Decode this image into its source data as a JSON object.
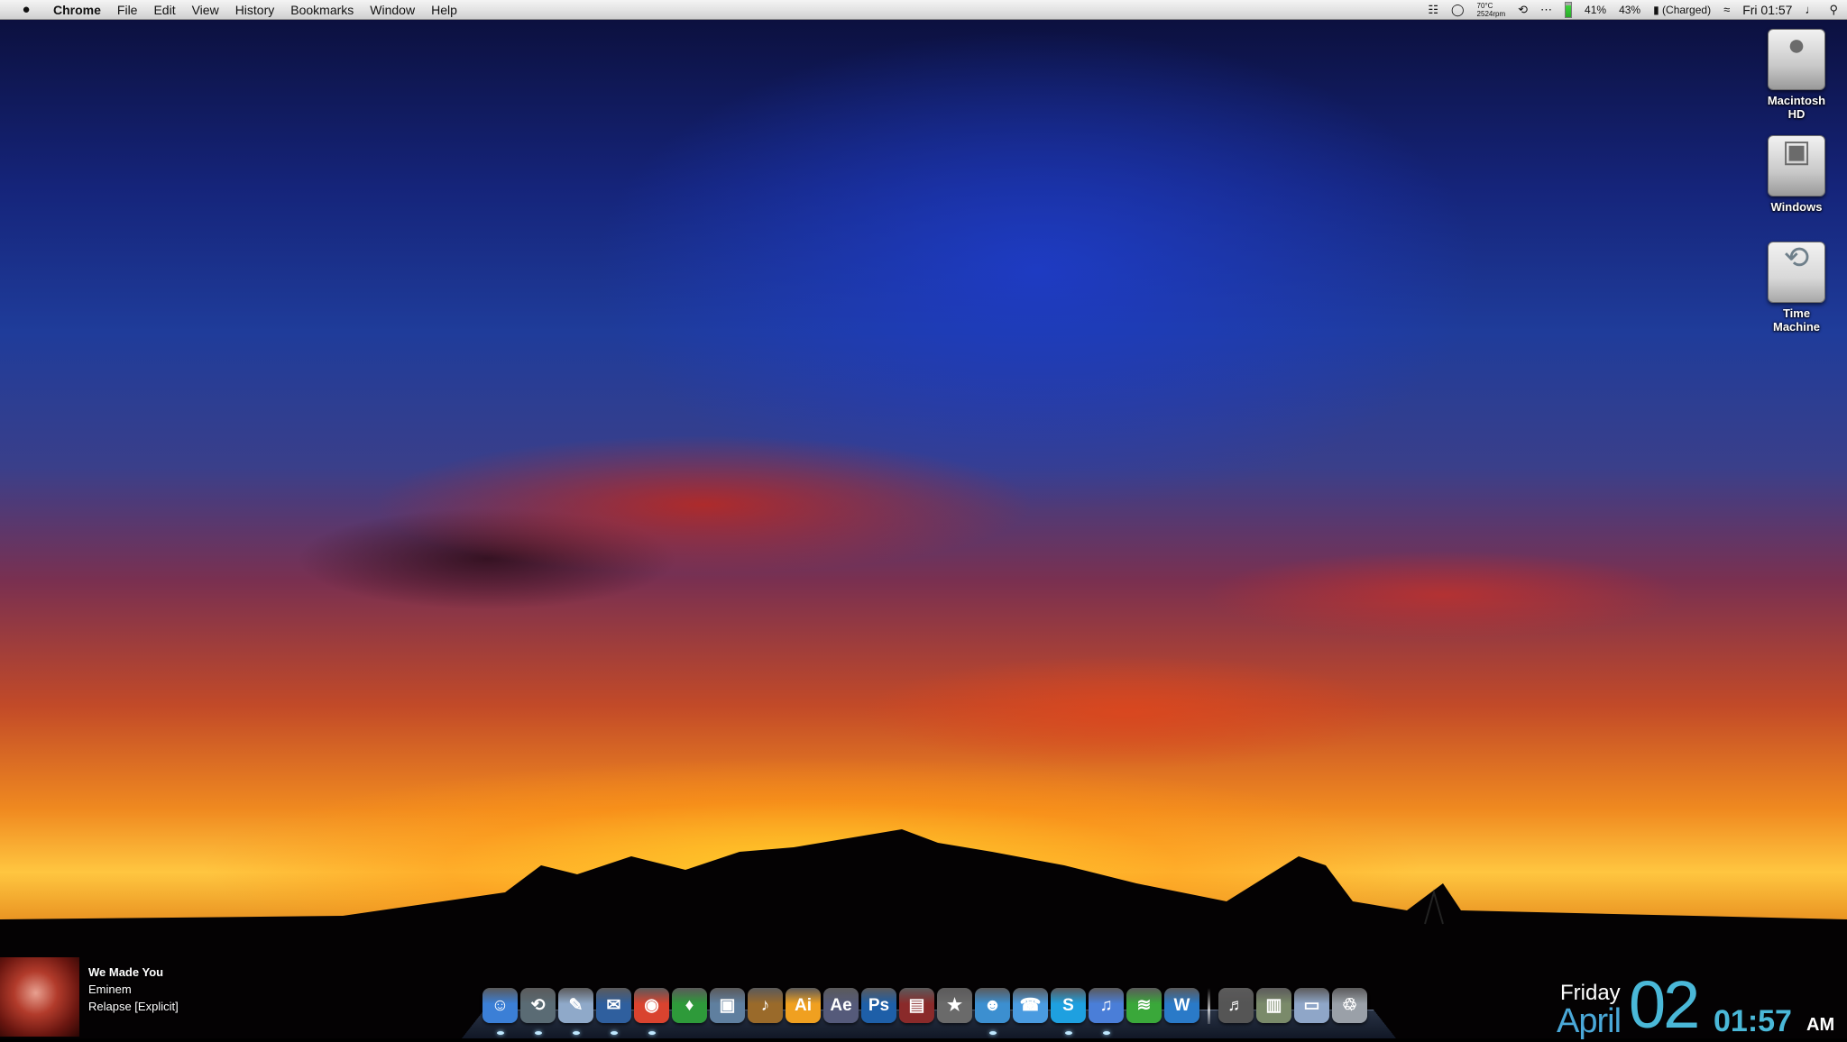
{
  "menubar": {
    "apple": "",
    "app_name": "Chrome",
    "items": [
      "File",
      "Edit",
      "View",
      "History",
      "Bookmarks",
      "Window",
      "Help"
    ],
    "status": {
      "temp": "70°C",
      "fan": "2524rpm",
      "cpu1": "41%",
      "cpu2": "43%",
      "battery": "(Charged)",
      "clock": "Fri 01:57"
    }
  },
  "desktop_icons": [
    {
      "label_1": "Macintosh",
      "label_2": "HD"
    },
    {
      "label_1": "Windows",
      "label_2": ""
    },
    {
      "label_1": "Time",
      "label_2": "Machine"
    }
  ],
  "now_playing": {
    "title": "We Made You",
    "artist": "Eminem",
    "album": "Relapse [Explicit]"
  },
  "dock": {
    "apps": [
      {
        "icon": "finder-icon",
        "glyph": "☺",
        "color": "#3b7fd6",
        "running": true
      },
      {
        "icon": "time-machine-icon",
        "glyph": "⟲",
        "color": "#5a6b74",
        "running": true
      },
      {
        "icon": "preview-icon",
        "glyph": "✎",
        "color": "#8fa9c9",
        "running": true
      },
      {
        "icon": "thunderbird-icon",
        "glyph": "✉",
        "color": "#2f5f9e",
        "running": true
      },
      {
        "icon": "chrome-icon",
        "glyph": "◉",
        "color": "#d9432f",
        "running": true
      },
      {
        "icon": "sims-icon",
        "glyph": "♦",
        "color": "#2e9a3a",
        "running": false
      },
      {
        "icon": "iphoto-icon",
        "glyph": "▣",
        "color": "#5f7f9f",
        "running": false
      },
      {
        "icon": "garageband-icon",
        "glyph": "♪",
        "color": "#9a6a2a",
        "running": false
      },
      {
        "icon": "illustrator-icon",
        "glyph": "Ai",
        "color": "#f0a020",
        "running": false
      },
      {
        "icon": "after-effects-icon",
        "glyph": "Ae",
        "color": "#555a7a",
        "running": false
      },
      {
        "icon": "photoshop-icon",
        "glyph": "Ps",
        "color": "#1e5fa8",
        "running": false
      },
      {
        "icon": "final-cut-icon",
        "glyph": "▤",
        "color": "#8a2a2a",
        "running": false
      },
      {
        "icon": "imovie-icon",
        "glyph": "★",
        "color": "#6a6a6a",
        "running": false
      },
      {
        "icon": "messenger-icon",
        "glyph": "☻",
        "color": "#3c8fd0",
        "running": true
      },
      {
        "icon": "ichat-icon",
        "glyph": "☎",
        "color": "#4a9be0",
        "running": false
      },
      {
        "icon": "skype-icon",
        "glyph": "S",
        "color": "#1ea0e0",
        "running": true
      },
      {
        "icon": "itunes-icon",
        "glyph": "♫",
        "color": "#4a7ed8",
        "running": true
      },
      {
        "icon": "spotify-icon",
        "glyph": "≋",
        "color": "#3aa83a",
        "running": false
      },
      {
        "icon": "word-icon",
        "glyph": "W",
        "color": "#2a7ac8",
        "running": false
      }
    ],
    "docs": [
      {
        "icon": "music-folder-icon",
        "glyph": "♬",
        "color": "#555555"
      },
      {
        "icon": "document-icon",
        "glyph": "▥",
        "color": "#7a8a6a"
      },
      {
        "icon": "downloads-folder-icon",
        "glyph": "▭",
        "color": "#8fa6c8"
      },
      {
        "icon": "trash-icon",
        "glyph": "♲",
        "color": "#9aa0a8"
      }
    ]
  },
  "datetime": {
    "day": "Friday",
    "month": "April",
    "date": "02",
    "time": "01:57",
    "ampm": "AM"
  }
}
